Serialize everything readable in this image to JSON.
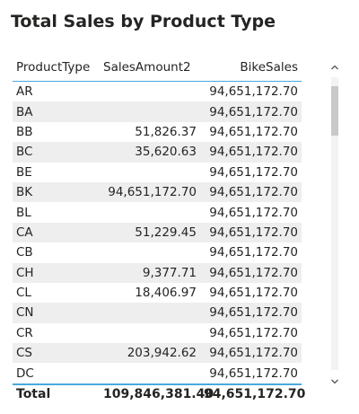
{
  "visual": {
    "title": "Total Sales by Product Type"
  },
  "table": {
    "columns": [
      "ProductType",
      "SalesAmount2",
      "BikeSales"
    ],
    "rows": [
      {
        "type": "AR",
        "sales": "",
        "bike": "94,651,172.70"
      },
      {
        "type": "BA",
        "sales": "",
        "bike": "94,651,172.70"
      },
      {
        "type": "BB",
        "sales": "51,826.37",
        "bike": "94,651,172.70"
      },
      {
        "type": "BC",
        "sales": "35,620.63",
        "bike": "94,651,172.70"
      },
      {
        "type": "BE",
        "sales": "",
        "bike": "94,651,172.70"
      },
      {
        "type": "BK",
        "sales": "94,651,172.70",
        "bike": "94,651,172.70"
      },
      {
        "type": "BL",
        "sales": "",
        "bike": "94,651,172.70"
      },
      {
        "type": "CA",
        "sales": "51,229.45",
        "bike": "94,651,172.70"
      },
      {
        "type": "CB",
        "sales": "",
        "bike": "94,651,172.70"
      },
      {
        "type": "CH",
        "sales": "9,377.71",
        "bike": "94,651,172.70"
      },
      {
        "type": "CL",
        "sales": "18,406.97",
        "bike": "94,651,172.70"
      },
      {
        "type": "CN",
        "sales": "",
        "bike": "94,651,172.70"
      },
      {
        "type": "CR",
        "sales": "",
        "bike": "94,651,172.70"
      },
      {
        "type": "CS",
        "sales": "203,942.62",
        "bike": "94,651,172.70"
      },
      {
        "type": "DC",
        "sales": "",
        "bike": "94,651,172.70"
      }
    ],
    "total": {
      "label": "Total",
      "sales": "109,846,381.40",
      "bike": "94,651,172.70"
    }
  },
  "colors": {
    "header_border": "#49a9e0",
    "alt_row": "#eeeeee",
    "text": "#252423"
  },
  "scrollbar": {
    "up_icon": "chevron-up-icon",
    "down_icon": "chevron-down-icon"
  }
}
